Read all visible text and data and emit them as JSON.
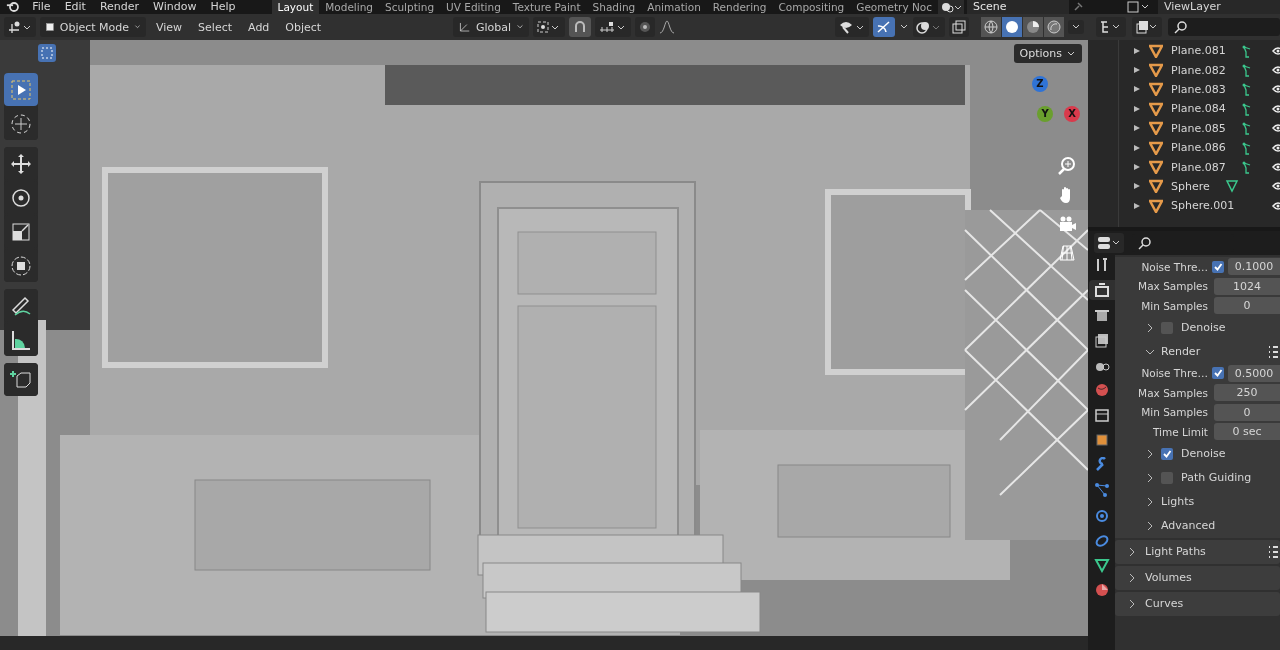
{
  "menu": [
    "File",
    "Edit",
    "Render",
    "Window",
    "Help"
  ],
  "workspaces": [
    {
      "label": "Layout",
      "selected": true
    },
    {
      "label": "Modeling",
      "selected": false
    },
    {
      "label": "Sculpting",
      "selected": false
    },
    {
      "label": "UV Editing",
      "selected": false
    },
    {
      "label": "Texture Paint",
      "selected": false
    },
    {
      "label": "Shading",
      "selected": false
    },
    {
      "label": "Animation",
      "selected": false
    },
    {
      "label": "Rendering",
      "selected": false
    },
    {
      "label": "Compositing",
      "selected": false
    },
    {
      "label": "Geometry Noc",
      "selected": false
    }
  ],
  "scene": {
    "name": "Scene"
  },
  "view_layer": {
    "name": "ViewLayer"
  },
  "header": {
    "mode": "Object Mode",
    "menus": [
      "View",
      "Select",
      "Add",
      "Object"
    ],
    "orientation": "Global",
    "gizmos_on": true,
    "shading": [
      {
        "selected": false
      },
      {
        "selected": true
      },
      {
        "selected": false
      },
      {
        "selected": false
      }
    ]
  },
  "toolbar": [
    [
      {
        "selected": true
      },
      {
        "selected": false
      }
    ],
    [
      {
        "selected": false
      },
      {
        "selected": false
      },
      {
        "selected": false
      },
      {
        "selected": false
      }
    ],
    [
      {
        "selected": false
      },
      {
        "selected": false
      }
    ],
    [
      {
        "selected": false
      }
    ]
  ],
  "viewport": {
    "options": "Options",
    "axes": [
      {
        "label": "Z",
        "color": "#2f73d6"
      },
      {
        "label": "Y",
        "color": "#6a9f2e"
      },
      {
        "label": "X",
        "color": "#d93a4c"
      }
    ]
  },
  "outliner": [
    {
      "name": "Plane.081",
      "kind": "hook"
    },
    {
      "name": "Plane.082",
      "kind": "hook"
    },
    {
      "name": "Plane.083",
      "kind": "hook"
    },
    {
      "name": "Plane.084",
      "kind": "hook"
    },
    {
      "name": "Plane.085",
      "kind": "hook"
    },
    {
      "name": "Plane.086",
      "kind": "hook"
    },
    {
      "name": "Plane.087",
      "kind": "hook"
    },
    {
      "name": "Sphere",
      "kind": "mesh"
    },
    {
      "name": "Sphere.001",
      "kind": "none"
    }
  ],
  "properties": {
    "tabs": [
      {
        "selected": false
      },
      {
        "selected": true
      },
      {
        "selected": false
      },
      {
        "selected": false
      },
      {
        "selected": false
      },
      {
        "selected": false
      },
      {
        "selected": false
      },
      {
        "selected": false
      },
      {
        "selected": false
      },
      {
        "selected": false
      },
      {
        "selected": false
      },
      {
        "selected": false
      },
      {
        "selected": false
      },
      {
        "selected": false
      }
    ],
    "rows": [
      {
        "kind": "field",
        "label": "Noise Thre…",
        "checked": true,
        "value": "0.1000"
      },
      {
        "kind": "field",
        "label": "Max Samples",
        "value": "1024"
      },
      {
        "kind": "field",
        "label": "Min Samples",
        "value": "0"
      },
      {
        "kind": "subpanel",
        "label": "Denoise",
        "expanded": false,
        "checked": false
      },
      {
        "kind": "subpanel",
        "label": "Render",
        "expanded": true,
        "presets": true
      },
      {
        "kind": "field",
        "label": "Noise Thre…",
        "checked": true,
        "value": "0.5000"
      },
      {
        "kind": "field",
        "label": "Max Samples",
        "value": "250"
      },
      {
        "kind": "field",
        "label": "Min Samples",
        "value": "0"
      },
      {
        "kind": "field",
        "label": "Time Limit",
        "value": "0 sec"
      },
      {
        "kind": "subpanel",
        "label": "Denoise",
        "expanded": false,
        "checked": true
      },
      {
        "kind": "subpanel",
        "label": "Path Guiding",
        "expanded": false,
        "checked": false
      },
      {
        "kind": "subpanel",
        "label": "Lights",
        "expanded": false
      },
      {
        "kind": "subpanel",
        "label": "Advanced",
        "expanded": false
      },
      {
        "kind": "panel",
        "label": "Light Paths",
        "expanded": false,
        "presets": true
      },
      {
        "kind": "panel",
        "label": "Volumes",
        "expanded": false
      },
      {
        "kind": "panel",
        "label": "Curves",
        "expanded": false
      }
    ]
  }
}
